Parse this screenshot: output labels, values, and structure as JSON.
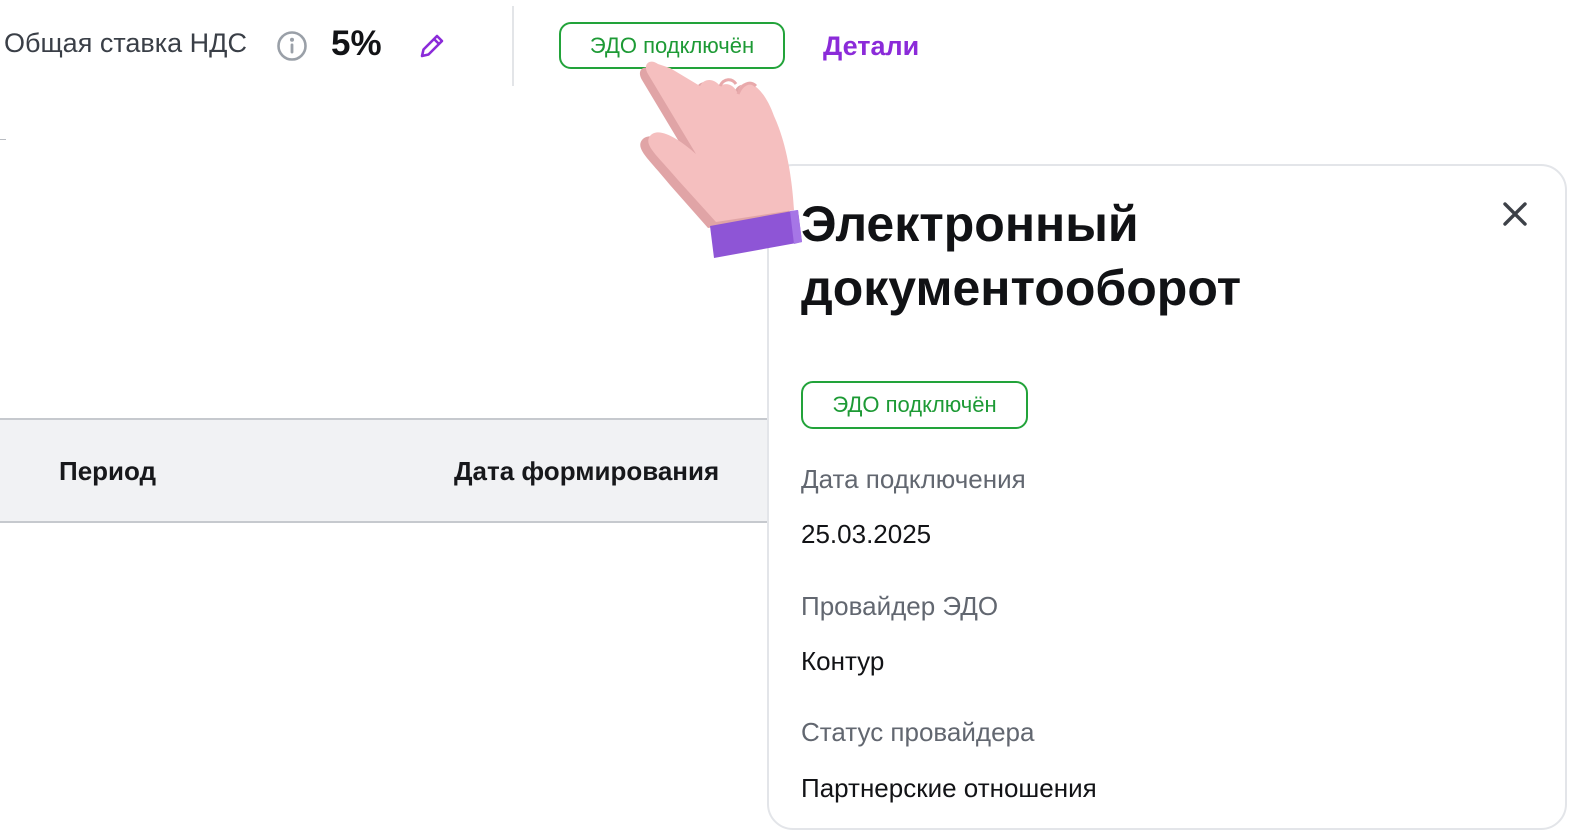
{
  "vat": {
    "label": "Общая ставка НДС",
    "value": "5%"
  },
  "edo_badge": {
    "label": "ЭДО подключён"
  },
  "details_link": "Детали",
  "table": {
    "columns": [
      "Период",
      "Дата формирования"
    ]
  },
  "panel": {
    "title": "Электронный документооборот",
    "status_badge": "ЭДО подключён",
    "fields": [
      {
        "label": "Дата подключения",
        "value": "25.03.2025"
      },
      {
        "label": "Провайдер ЭДО",
        "value": "Контур"
      },
      {
        "label": "Статус провайдера",
        "value": "Партнерские отношения"
      }
    ]
  },
  "colors": {
    "accent_purple": "#8b2bd9",
    "success_green": "#22a33a",
    "text_primary": "#121316",
    "text_secondary": "#626770",
    "table_header_bg": "#f1f2f4"
  },
  "icons": [
    "info-icon",
    "pencil-icon",
    "close-icon",
    "pointing-hand-icon"
  ]
}
